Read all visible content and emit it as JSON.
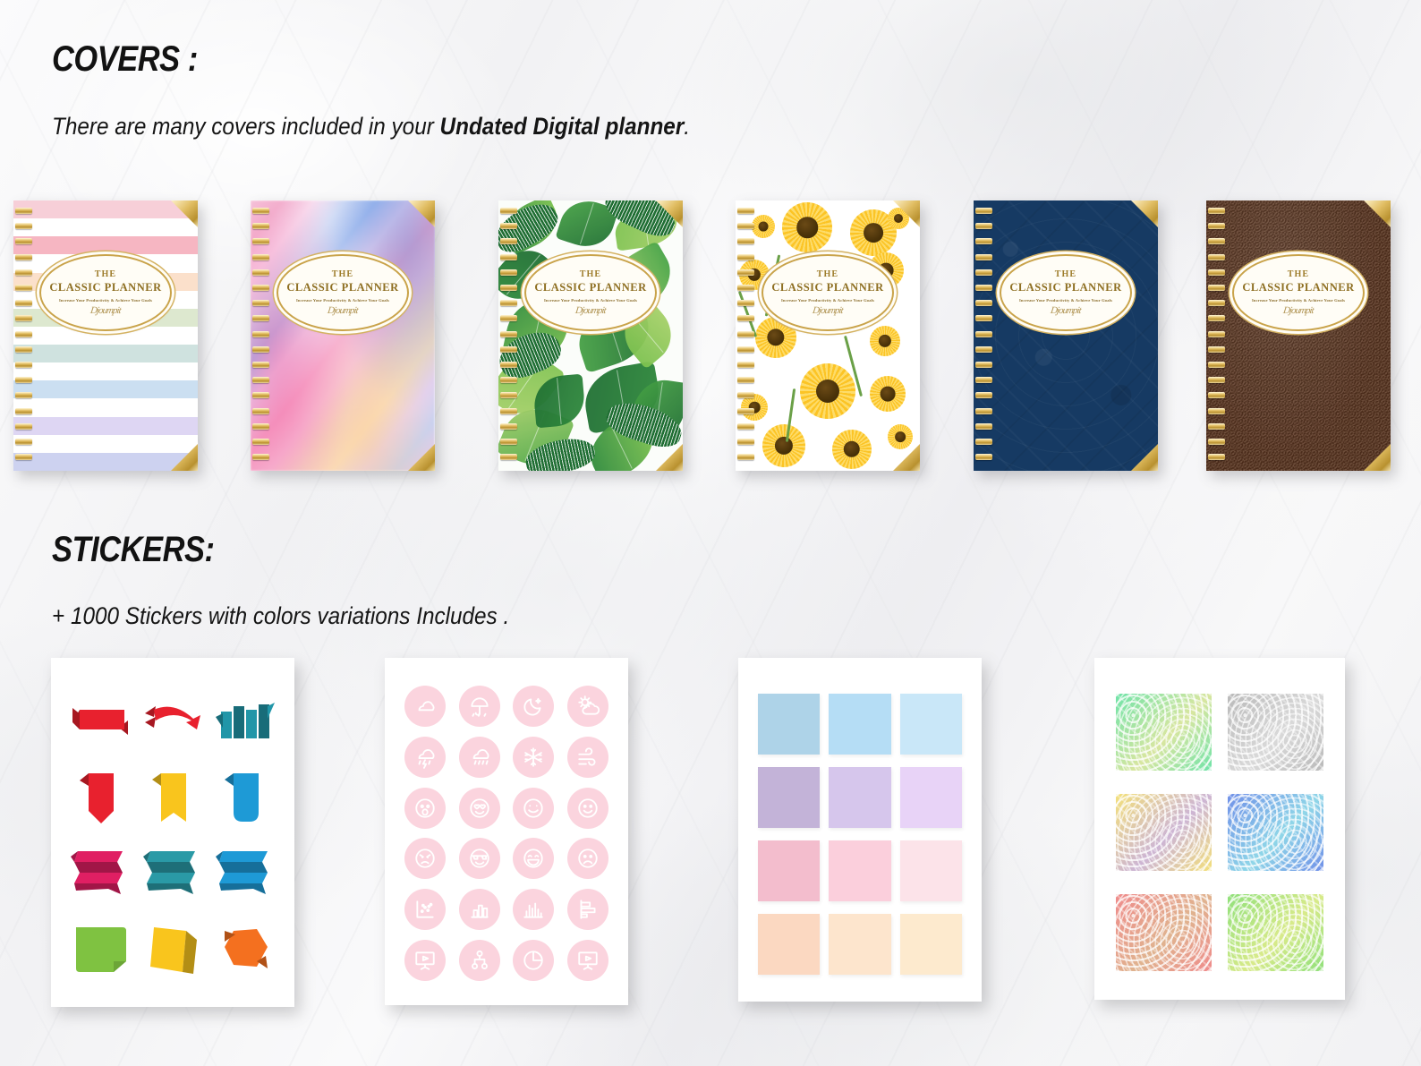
{
  "sections": {
    "covers": {
      "heading": "COVERS :",
      "subtitle_prefix": "There are many covers included in your ",
      "subtitle_bold": "Undated Digital planner",
      "subtitle_suffix": "."
    },
    "stickers": {
      "heading": "STICKERS:",
      "subtitle": "+ 1000 Stickers with colors variations Includes ."
    }
  },
  "cover_label": {
    "the": "THE",
    "title": "CLASSIC PLANNER",
    "tagline": "Increase Your Productivity & Achieve Your Goals",
    "signature": "Djoumpit"
  },
  "covers": [
    {
      "name": "pastel-stripes",
      "style": "stripes",
      "description": "Pastel horizontal stripes",
      "colors": [
        "#f7cfd8",
        "#ffffff",
        "#f6b6c2",
        "#ffffff",
        "#fbe0cb",
        "#ffffff",
        "#dde8cf",
        "#ffffff",
        "#cfe2df",
        "#ffffff",
        "#cbdff1",
        "#ffffff",
        "#ded6f3",
        "#ffffff",
        "#cdd2f0"
      ]
    },
    {
      "name": "watercolor-pastel",
      "style": "watercolor",
      "description": "Diagonal pastel watercolor streaks",
      "colors": [
        "#f5a8cd",
        "#9fb9ee",
        "#e8cdec",
        "#fbe0c0"
      ]
    },
    {
      "name": "tropical-leaves",
      "style": "tropical",
      "description": "Watercolor tropical palm leaves",
      "colors": [
        "#2f8a3c",
        "#4aa547",
        "#7cc24f",
        "#1f6e33",
        "#a8d16a"
      ]
    },
    {
      "name": "sunflowers",
      "style": "sunflower",
      "description": "Sunflowers on white",
      "colors": [
        "#fcc425",
        "#fddc6a",
        "#4a3209",
        "#6aa047"
      ]
    },
    {
      "name": "navy-damask",
      "style": "navy",
      "description": "Navy blue embossed damask",
      "colors": [
        "#163a63"
      ]
    },
    {
      "name": "brown-leather",
      "style": "leather",
      "description": "Brown pebbled leather",
      "colors": [
        "#5a3520"
      ]
    }
  ],
  "sticker_sheets": [
    {
      "name": "ribbon-banners",
      "description": "Origami ribbon banner stickers",
      "items": [
        {
          "shape": "ribbon-flat",
          "color": "#e8212e"
        },
        {
          "shape": "arrow-ribbon",
          "color": "#e8212e"
        },
        {
          "shape": "folded-zigzag",
          "color": "#2196a8"
        },
        {
          "shape": "bookmark-point",
          "color": "#e8212e"
        },
        {
          "shape": "bookmark-notch",
          "color": "#f9c51d"
        },
        {
          "shape": "bookmark-round",
          "color": "#1e9ad6"
        },
        {
          "shape": "accordion",
          "color": "#e01f63"
        },
        {
          "shape": "accordion",
          "color": "#2a9aa6"
        },
        {
          "shape": "accordion",
          "color": "#1e9ad6"
        },
        {
          "shape": "note-corner",
          "color": "#7fc241"
        },
        {
          "shape": "folded-card",
          "color": "#f9c51d"
        },
        {
          "shape": "hex-ribbon",
          "color": "#f4701f"
        }
      ]
    },
    {
      "name": "pink-circle-icons",
      "description": "Pink circular line icons: weather, emoji, charts",
      "circle_color": "#fbd4de",
      "icons": [
        "cloud-icon",
        "umbrella-rain-icon",
        "moon-stars-icon",
        "sun-cloud-icon",
        "thunderstorm-icon",
        "rain-cloud-icon",
        "snowflake-icon",
        "wind-icon",
        "surprised-face-icon",
        "heart-eyes-face-icon",
        "smiling-face-icon",
        "happy-face-icon",
        "angry-face-icon",
        "sunglasses-face-icon",
        "laughing-face-icon",
        "sad-face-icon",
        "scatter-chart-icon",
        "bar-chart-icon",
        "column-chart-icon",
        "horizontal-bar-chart-icon",
        "presentation-play-icon",
        "org-chart-icon",
        "pie-chart-icon",
        "presentation-play-icon"
      ]
    },
    {
      "name": "pastel-color-swatches",
      "description": "Pastel color block stickers",
      "swatches": [
        "#aed3e8",
        "#b5ddf5",
        "#c9e7f8",
        "#c3b3d8",
        "#d6c6ec",
        "#e8d3f7",
        "#f3bdcd",
        "#fbcfdc",
        "#fce3e9",
        "#fbd8c1",
        "#fde5cd",
        "#fdeace"
      ]
    },
    {
      "name": "watercolor-textures",
      "description": "Watercolor texture block stickers",
      "textures": [
        {
          "name": "mint-green",
          "from": "#6fe3a8",
          "to": "#d8e6a0"
        },
        {
          "name": "grey",
          "from": "#b9b9b9",
          "to": "#d9d9d9"
        },
        {
          "name": "gold-lilac",
          "from": "#f3e07a",
          "to": "#cdb5d4"
        },
        {
          "name": "blue-violet",
          "from": "#6f8fe8",
          "to": "#8fd6e8"
        },
        {
          "name": "coral-rose",
          "from": "#ef8b8b",
          "to": "#e0b38f"
        },
        {
          "name": "lime-green",
          "from": "#8fe07a",
          "to": "#d8ea8a"
        }
      ]
    }
  ]
}
